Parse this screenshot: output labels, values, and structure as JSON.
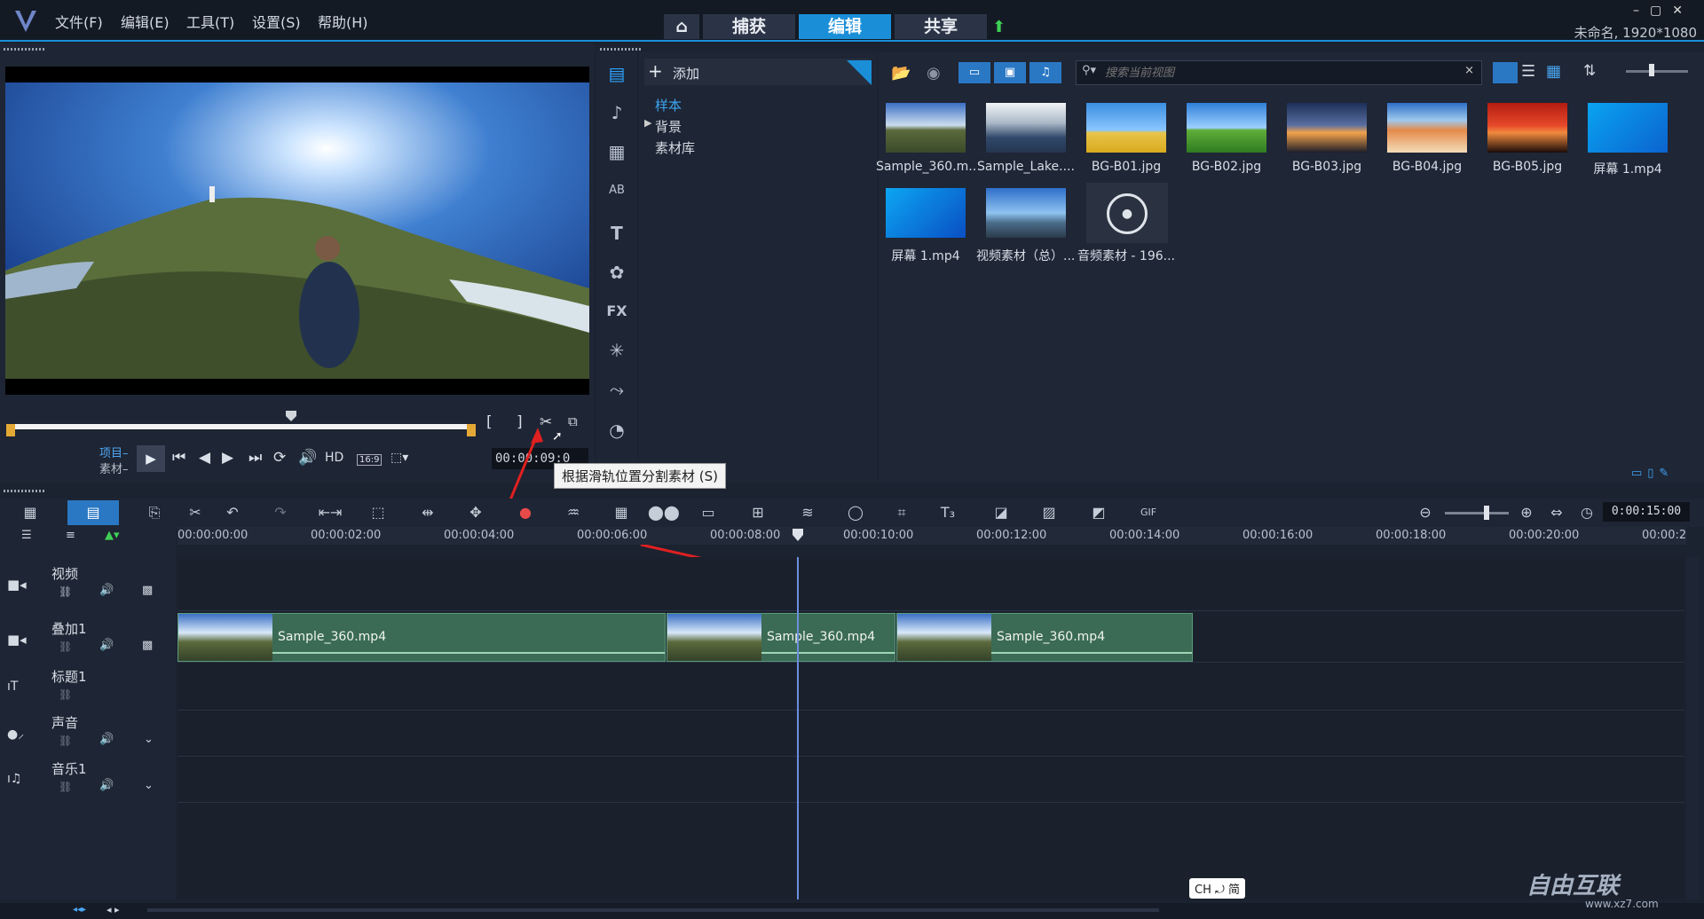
{
  "menu": [
    "文件(F)",
    "编辑(E)",
    "工具(T)",
    "设置(S)",
    "帮助(H)"
  ],
  "mode_tabs": [
    {
      "label": "捕获"
    },
    {
      "label": "编辑"
    },
    {
      "label": "共享"
    }
  ],
  "title_info": "未命名, 1920*1080",
  "preview": {
    "project_label": "项目–",
    "clip_label": "素材–",
    "hd_label": "HD",
    "aspect": "16:9",
    "timecode": "00:00:09:0",
    "tooltip": "根据滑轨位置分割素材 (S)"
  },
  "library": {
    "add_label": "添加",
    "tree": [
      "样本",
      "背景",
      "素材库"
    ],
    "search_placeholder": "搜索当前视图",
    "items": [
      {
        "label": "Sample_360.m..."
      },
      {
        "label": "Sample_Lake...."
      },
      {
        "label": "BG-B01.jpg"
      },
      {
        "label": "BG-B02.jpg"
      },
      {
        "label": "BG-B03.jpg"
      },
      {
        "label": "BG-B04.jpg"
      },
      {
        "label": "BG-B05.jpg"
      },
      {
        "label": "屏幕 1.mp4"
      },
      {
        "label": "屏幕 1.mp4"
      },
      {
        "label": "视频素材（总）...."
      },
      {
        "label": "音频素材 - 196..."
      }
    ]
  },
  "timeline": {
    "duration": "0:00:15:00",
    "ruler": [
      "00:00:00:00",
      "00:00:02:00",
      "00:00:04:00",
      "00:00:06:00",
      "00:00:08:00",
      "00:00:10:00",
      "00:00:12:00",
      "00:00:14:00",
      "00:00:16:00",
      "00:00:18:00",
      "00:00:20:00",
      "00:00:2"
    ],
    "tracks": [
      {
        "name": "视频"
      },
      {
        "name": "叠加1"
      },
      {
        "name": "标题1"
      },
      {
        "name": "声音"
      },
      {
        "name": "音乐1"
      }
    ],
    "clips": [
      {
        "name": "Sample_360.mp4"
      },
      {
        "name": "Sample_360.mp4"
      },
      {
        "name": "Sample_360.mp4"
      }
    ]
  },
  "ime": "CH ⤾ 简",
  "watermark": "自由互联",
  "watermark_url": "www.xz7.com"
}
